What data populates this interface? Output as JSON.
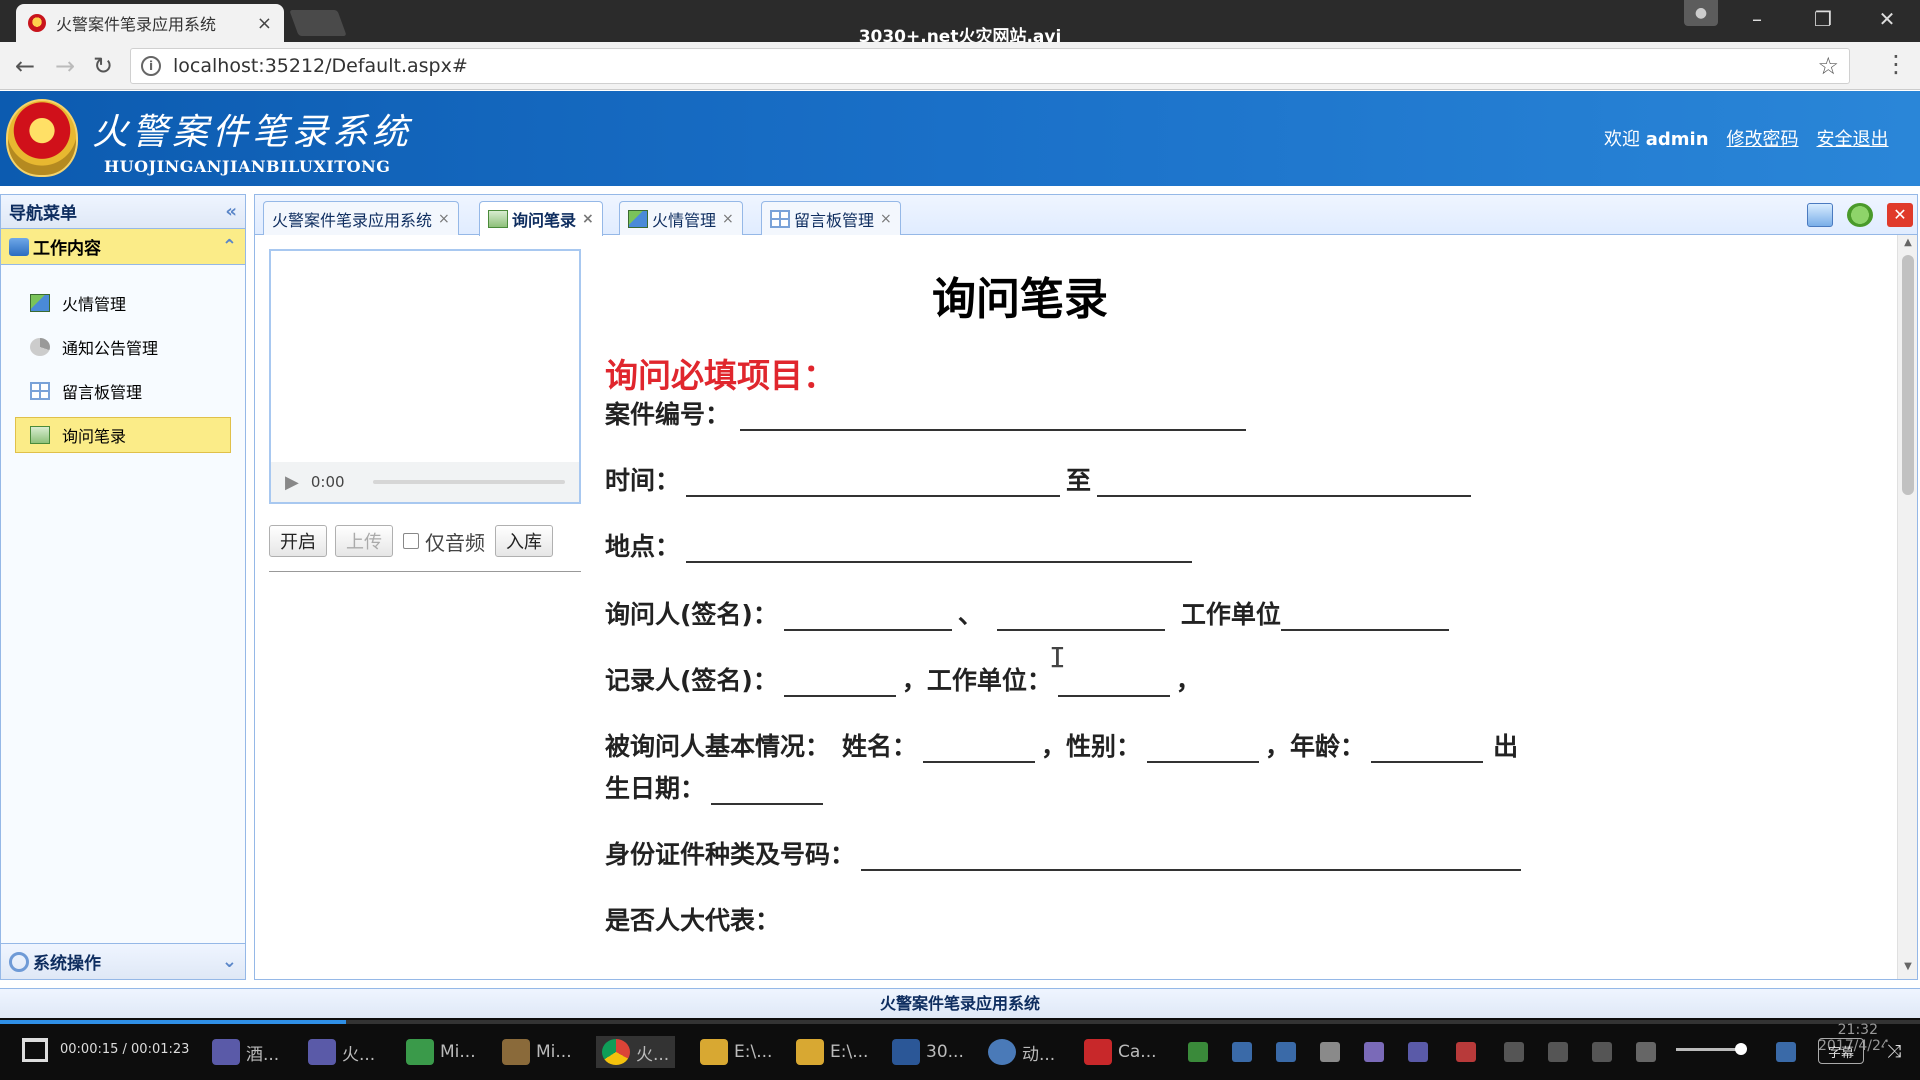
{
  "browser": {
    "tab_title": "火警案件笔录应用系统",
    "tab_close": "×",
    "video_title": "3030+.net火灾网站.avi",
    "url": "localhost:35212/Default.aspx#"
  },
  "header": {
    "logo_text": "火警案件笔录系统",
    "logo_pinyin": "HUOJINGANJIANBILUXITONG",
    "welcome": "欢迎",
    "username": "admin",
    "change_password": "修改密码",
    "logout": "安全退出"
  },
  "sidebar": {
    "title": "导航菜单",
    "collapse_icon": "«",
    "group_title": "工作内容",
    "group_icon": "double-up-chevron",
    "items": [
      {
        "label": "火情管理",
        "icon": "fire-map-icon"
      },
      {
        "label": "通知公告管理",
        "icon": "megaphone-icon"
      },
      {
        "label": "留言板管理",
        "icon": "grid-icon"
      },
      {
        "label": "询问笔录",
        "icon": "form-icon",
        "active": true
      }
    ],
    "footer_group": "系统操作"
  },
  "tabs": [
    {
      "label": "火警案件笔录应用系统",
      "close": "×"
    },
    {
      "label": "询问笔录",
      "close": "×",
      "active": true
    },
    {
      "label": "火情管理",
      "close": "×"
    },
    {
      "label": "留言板管理",
      "close": "×"
    }
  ],
  "media": {
    "time": "0:00",
    "btn_start": "开启",
    "btn_upload": "上传",
    "chk_audio_only": "仅音频",
    "btn_store": "入库"
  },
  "form": {
    "title": "询问笔录",
    "required_heading": "询问必填项目：",
    "case_no": "案件编号：",
    "time": "时间：",
    "to": "至",
    "place": "地点：",
    "inquirer": "询问人(签名)：",
    "comma": "、",
    "work_unit": "工作单位",
    "recorder": "记录人(签名)：",
    "recorder_unit": "，工作单位：",
    "trailing_comma": "，",
    "basic_info": "被询问人基本情况：",
    "name": "姓名：",
    "gender": "，性别：",
    "age": "，年龄：",
    "birth_1": "出",
    "birth_2": "生日期：",
    "id_card": "身份证件种类及号码：",
    "npc_rep": "是否人大代表："
  },
  "footer": {
    "text": "火警案件笔录应用系统"
  },
  "player": {
    "time": "00:00:15 / 00:01:23",
    "progress": 0.18,
    "subtitle_btn": "字幕",
    "clock_time": "21:32",
    "clock_date": "2017/4/24"
  },
  "taskbar": [
    {
      "label": "酒...",
      "icon": "app-icon"
    },
    {
      "label": "火...",
      "icon": "app-icon"
    },
    {
      "label": "Mi...",
      "icon": "excel-icon"
    },
    {
      "label": "Mi...",
      "icon": "tools-icon"
    },
    {
      "label": "火...",
      "icon": "chrome-icon",
      "active": true
    },
    {
      "label": "E:\\...",
      "icon": "folder-icon"
    },
    {
      "label": "E:\\...",
      "icon": "folder-icon"
    },
    {
      "label": "30...",
      "icon": "word-icon"
    },
    {
      "label": "动...",
      "icon": "app-icon"
    },
    {
      "label": "Ca...",
      "icon": "camtasia-icon"
    }
  ],
  "colors": {
    "header_blue": "#1a70c8",
    "nav_highlight": "#fbec88",
    "required_red": "#e0262d",
    "panel_border": "#95b8e7"
  }
}
